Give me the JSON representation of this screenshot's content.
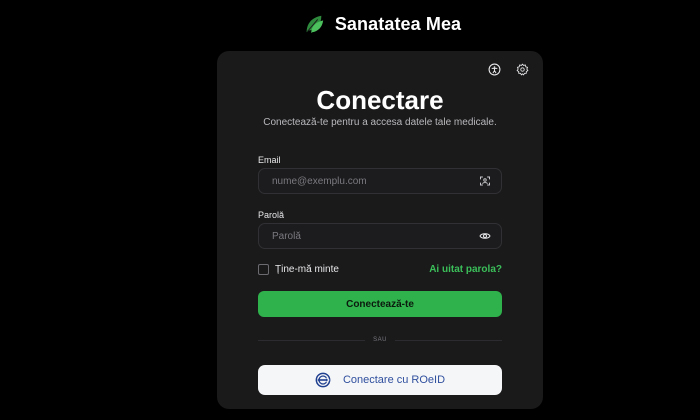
{
  "brand": {
    "name": "Sanatatea Mea",
    "icon": "leaf-icon",
    "accent_color": "#2fb14c"
  },
  "toolbar": {
    "accessibility_icon": "accessibility-icon",
    "settings_icon": "gear-icon"
  },
  "login": {
    "title": "Conectare",
    "subtitle": "Conectează-te pentru a accesa datele tale medicale.",
    "email_label": "Email",
    "email_placeholder": "nume@exemplu.com",
    "email_value": "",
    "email_icon": "face-scan-icon",
    "password_label": "Parolă",
    "password_placeholder": "Parolă",
    "password_value": "",
    "password_icon": "eye-icon",
    "remember_label": "Ține-mă minte",
    "remember_checked": false,
    "forgot_label": "Ai uitat parola?",
    "submit_label": "Conectează-te",
    "divider_text": "SAU",
    "roeid_label": "Conectare cu ROeID",
    "roeid_icon": "roeid-logo-icon"
  }
}
